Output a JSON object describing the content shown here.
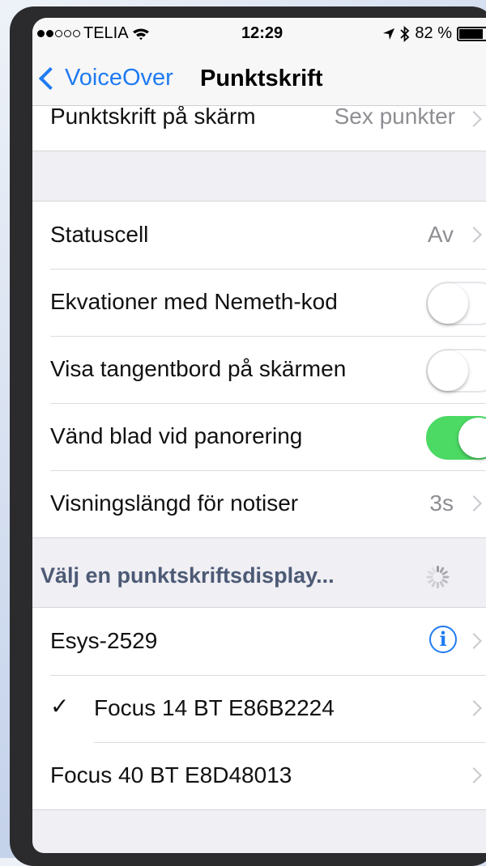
{
  "status_bar": {
    "carrier": "TELIA",
    "time": "12:29",
    "battery": "82 %",
    "signal_bars_filled": 2,
    "signal_bars_total": 5
  },
  "nav": {
    "back_label": "VoiceOver",
    "title": "Punktskrift"
  },
  "cut_row": {
    "label": "Punktskrift på skärm",
    "value": "Sex punkter"
  },
  "settings": {
    "statuscell": {
      "label": "Statuscell",
      "value": "Av"
    },
    "nemeth": {
      "label": "Ekvationer med Nemeth-kod",
      "on": false
    },
    "keyboard": {
      "label": "Visa tangentbord på skärmen",
      "on": false
    },
    "turn_pages": {
      "label": "Vänd blad vid panorering",
      "on": true
    },
    "notif_duration": {
      "label": "Visningslängd för notiser",
      "value": "3s"
    }
  },
  "displays": {
    "header": "Välj en punktskriftsdisplay...",
    "items": [
      {
        "label": "Esys-2529",
        "info": "i"
      },
      {
        "label": "Focus 14 BT E86B2224",
        "checked": true
      },
      {
        "label": "Focus 40 BT E8D48013"
      }
    ]
  },
  "colors": {
    "accent": "#1f7bf2",
    "toggle_on": "#4cd964",
    "header": "#4d5a75"
  }
}
